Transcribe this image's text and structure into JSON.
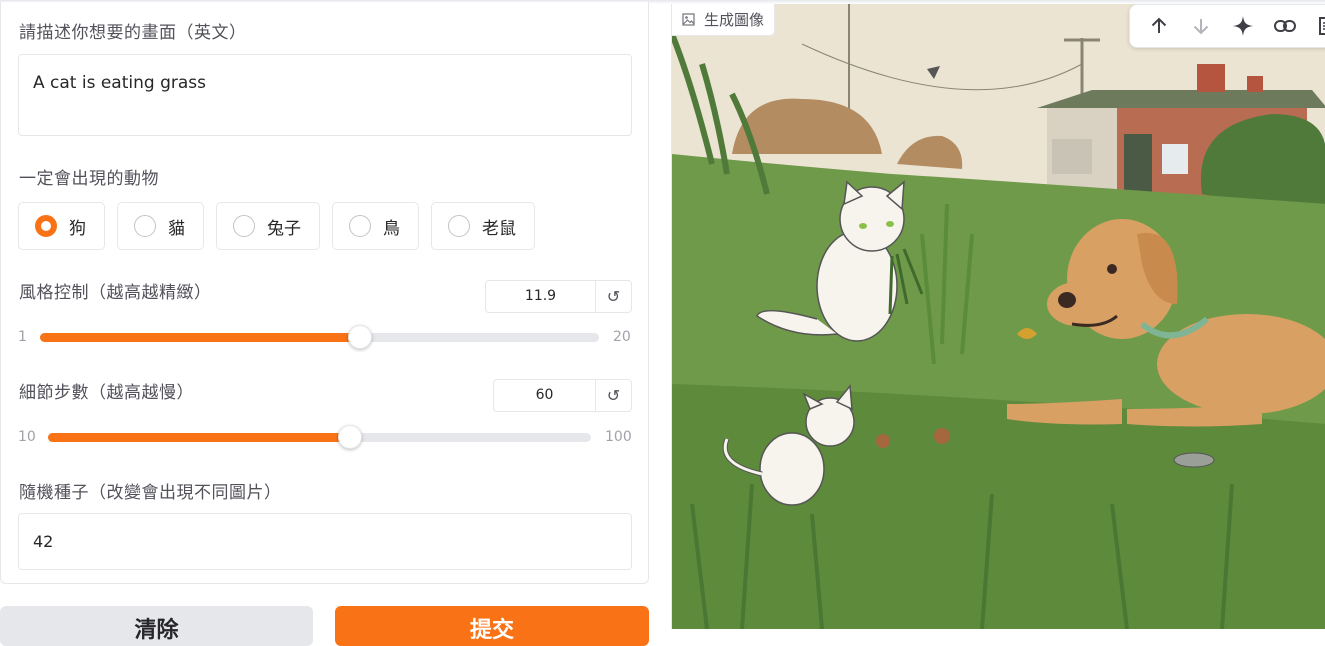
{
  "prompt": {
    "label": "請描述你想要的畫面（英文）",
    "value": "A cat is eating grass"
  },
  "animal": {
    "label": "一定會出現的動物",
    "options": [
      "狗",
      "貓",
      "兔子",
      "鳥",
      "老鼠"
    ],
    "selected": "狗"
  },
  "style_control": {
    "label": "風格控制（越高越精緻）",
    "value": "11.9",
    "min": "1",
    "max": "20",
    "fraction": 0.573
  },
  "detail_steps": {
    "label": "細節步數（越高越慢）",
    "value": "60",
    "min": "10",
    "max": "100",
    "fraction": 0.556
  },
  "seed": {
    "label": "隨機種子（改變會出現不同圖片）",
    "value": "42"
  },
  "buttons": {
    "clear": "清除",
    "submit": "提交"
  },
  "output": {
    "label": "生成圖像",
    "toolbar_icons": [
      "arrow-up-icon",
      "arrow-down-icon",
      "sparkle-icon",
      "link-icon",
      "document-icon"
    ]
  },
  "colors": {
    "accent": "#f97316",
    "border": "#e5e7eb",
    "grass": "#6f9a4a",
    "sky": "#ece4d3"
  }
}
